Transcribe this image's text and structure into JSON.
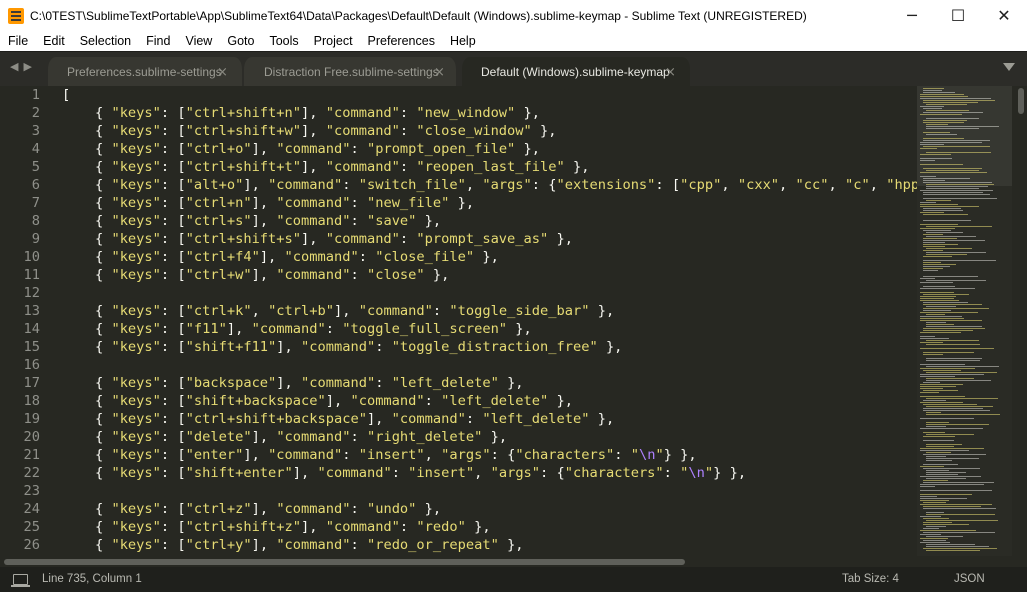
{
  "window": {
    "title": "C:\\0TEST\\SublimeTextPortable\\App\\SublimeText64\\Data\\Packages\\Default\\Default (Windows).sublime-keymap - Sublime Text (UNREGISTERED)",
    "minimize_glyph": "─",
    "maximize_glyph": "☐",
    "close_glyph": "✕",
    "icon": "sublime-text-logo-icon"
  },
  "menu": [
    "File",
    "Edit",
    "Selection",
    "Find",
    "View",
    "Goto",
    "Tools",
    "Project",
    "Preferences",
    "Help"
  ],
  "tabs": [
    {
      "label": "Preferences.sublime-settings",
      "active": false,
      "close": "×"
    },
    {
      "label": "Distraction Free.sublime-settings",
      "active": false,
      "close": "×"
    },
    {
      "label": "Default (Windows).sublime-keymap",
      "active": true,
      "close": "×"
    }
  ],
  "nav": {
    "back": "◀",
    "forward": "▶"
  },
  "editor": {
    "line_numbers": [
      "1",
      "2",
      "3",
      "4",
      "5",
      "6",
      "7",
      "8",
      "9",
      "10",
      "11",
      "12",
      "13",
      "14",
      "15",
      "16",
      "17",
      "18",
      "19",
      "20",
      "21",
      "22",
      "23",
      "24",
      "25",
      "26"
    ],
    "lines": [
      "[",
      "    { \"keys\": [\"ctrl+shift+n\"], \"command\": \"new_window\" },",
      "    { \"keys\": [\"ctrl+shift+w\"], \"command\": \"close_window\" },",
      "    { \"keys\": [\"ctrl+o\"], \"command\": \"prompt_open_file\" },",
      "    { \"keys\": [\"ctrl+shift+t\"], \"command\": \"reopen_last_file\" },",
      "    { \"keys\": [\"alt+o\"], \"command\": \"switch_file\", \"args\": {\"extensions\": [\"cpp\", \"cxx\", \"cc\", \"c\", \"hpp\"",
      "    { \"keys\": [\"ctrl+n\"], \"command\": \"new_file\" },",
      "    { \"keys\": [\"ctrl+s\"], \"command\": \"save\" },",
      "    { \"keys\": [\"ctrl+shift+s\"], \"command\": \"prompt_save_as\" },",
      "    { \"keys\": [\"ctrl+f4\"], \"command\": \"close_file\" },",
      "    { \"keys\": [\"ctrl+w\"], \"command\": \"close\" },",
      "",
      "    { \"keys\": [\"ctrl+k\", \"ctrl+b\"], \"command\": \"toggle_side_bar\" },",
      "    { \"keys\": [\"f11\"], \"command\": \"toggle_full_screen\" },",
      "    { \"keys\": [\"shift+f11\"], \"command\": \"toggle_distraction_free\" },",
      "",
      "    { \"keys\": [\"backspace\"], \"command\": \"left_delete\" },",
      "    { \"keys\": [\"shift+backspace\"], \"command\": \"left_delete\" },",
      "    { \"keys\": [\"ctrl+shift+backspace\"], \"command\": \"left_delete\" },",
      "    { \"keys\": [\"delete\"], \"command\": \"right_delete\" },",
      "    { \"keys\": [\"enter\"], \"command\": \"insert\", \"args\": {\"characters\": \"\\n\"} },",
      "    { \"keys\": [\"shift+enter\"], \"command\": \"insert\", \"args\": {\"characters\": \"\\n\"} },",
      "",
      "    { \"keys\": [\"ctrl+z\"], \"command\": \"undo\" },",
      "    { \"keys\": [\"ctrl+shift+z\"], \"command\": \"redo\" },",
      "    { \"keys\": [\"ctrl+y\"], \"command\": \"redo_or_repeat\" },"
    ]
  },
  "status": {
    "position": "Line 735, Column 1",
    "tab_size": "Tab Size: 4",
    "syntax": "JSON",
    "icon": "panel-toggle-icon"
  },
  "colors": {
    "background": "#272822",
    "foreground": "#f8f8f2",
    "string": "#e6db74",
    "escape": "#ae81ff",
    "gutter": "#8f908a"
  }
}
